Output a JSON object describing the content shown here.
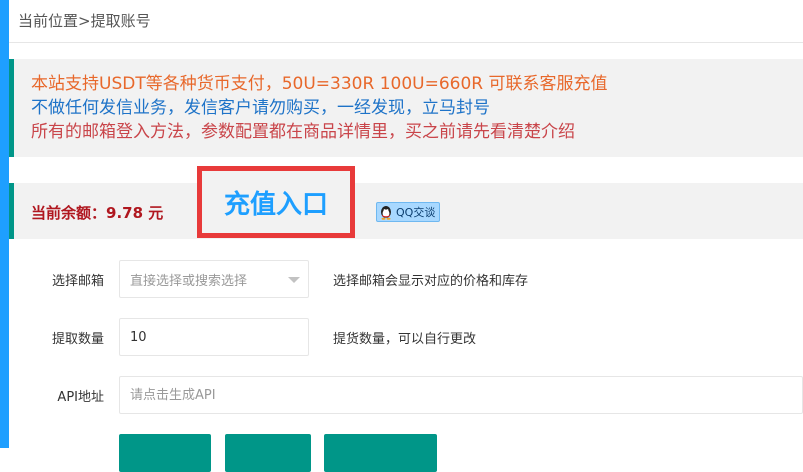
{
  "breadcrumb": "当前位置>提取账号",
  "notice": {
    "line1": "本站支持USDT等各种货币支付，50U=330R 100U=660R  可联系客服充值",
    "line2": "不做任何发信业务，发信客户请勿购买，一经发现，立马封号",
    "line3": "所有的邮箱登入方法，参数配置都在商品详情里，买之前请先看清楚介绍"
  },
  "balance": {
    "text": "当前余额：9.78  元",
    "recharge_label": "充值入口",
    "qq_label": "QQ交谈"
  },
  "form": {
    "mailbox": {
      "label": "选择邮箱",
      "placeholder": "直接选择或搜索选择",
      "hint": "选择邮箱会显示对应的价格和库存"
    },
    "quantity": {
      "label": "提取数量",
      "value": "10",
      "hint": "提货数量，可以自行更改"
    },
    "api": {
      "label": "API地址",
      "placeholder": "请点击生成API"
    }
  },
  "colors": {
    "accent": "#1e9fff",
    "teal": "#009688",
    "notice_orange": "#e8682b",
    "notice_blue": "#1e73c8",
    "notice_red": "#c9454a",
    "balance_red": "#b0171f",
    "highlight_box": "#e83a3a"
  }
}
